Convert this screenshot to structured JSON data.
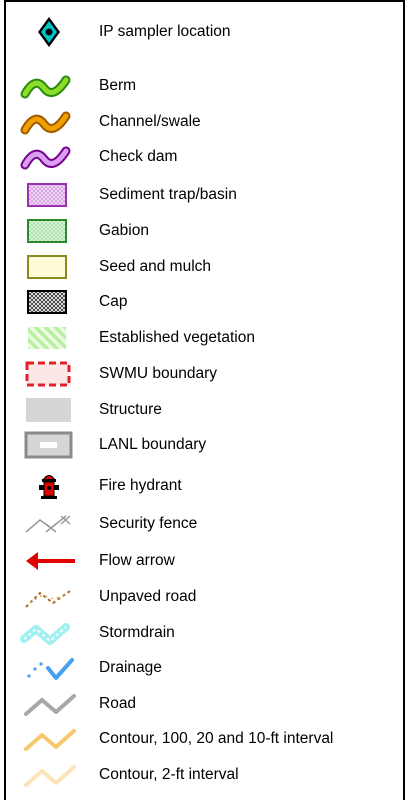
{
  "legend": {
    "items": [
      {
        "id": "ip-sampler",
        "label": "IP sampler location",
        "icon": "diamond-icon",
        "color": "#00c8c8"
      },
      {
        "id": "berm",
        "label": "Berm",
        "icon": "berm-icon",
        "color": "#8cdc28"
      },
      {
        "id": "channel",
        "label": "Channel/swale",
        "icon": "channel-swale-icon",
        "color": "#f0a000"
      },
      {
        "id": "check-dam",
        "label": "Check dam",
        "icon": "check-dam-icon",
        "color": "#b400c8"
      },
      {
        "id": "sediment",
        "label": "Sediment trap/basin",
        "icon": "sediment-trap-icon",
        "color": "#9b30b0"
      },
      {
        "id": "gabion",
        "label": "Gabion",
        "icon": "gabion-icon",
        "color": "#3c9a3c"
      },
      {
        "id": "seed",
        "label": "Seed and mulch",
        "icon": "seed-mulch-icon",
        "color": "#a09a2a"
      },
      {
        "id": "cap",
        "label": "Cap",
        "icon": "cap-icon",
        "color": "#000000"
      },
      {
        "id": "vegetation",
        "label": "Established vegetation",
        "icon": "vegetation-icon",
        "color": "#b8f0a0"
      },
      {
        "id": "swmu",
        "label": "SWMU boundary",
        "icon": "swmu-boundary-icon",
        "color": "#e0202a"
      },
      {
        "id": "structure",
        "label": "Structure",
        "icon": "structure-icon",
        "color": "#d6d6d6"
      },
      {
        "id": "lanl",
        "label": "LANL boundary",
        "icon": "lanl-boundary-icon",
        "color": "#8a8a8a"
      },
      {
        "id": "hydrant",
        "label": "Fire hydrant",
        "icon": "fire-hydrant-icon",
        "color": "#e00000"
      },
      {
        "id": "fence",
        "label": "Security fence",
        "icon": "security-fence-icon",
        "color": "#9a9a9a"
      },
      {
        "id": "flow",
        "label": "Flow arrow",
        "icon": "flow-arrow-icon",
        "color": "#e00000"
      },
      {
        "id": "unpaved",
        "label": "Unpaved road",
        "icon": "unpaved-road-icon",
        "color": "#b06a2a"
      },
      {
        "id": "stormdrain",
        "label": "Stormdrain",
        "icon": "stormdrain-icon",
        "color": "#a0f0f0"
      },
      {
        "id": "drainage",
        "label": "Drainage",
        "icon": "drainage-icon",
        "color": "#4aa0f0"
      },
      {
        "id": "road",
        "label": "Road",
        "icon": "road-icon",
        "color": "#a8a8a8"
      },
      {
        "id": "contour-100",
        "label": "Contour, 100, 20 and 10-ft interval",
        "icon": "contour-major-icon",
        "color": "#f8c870"
      },
      {
        "id": "contour-2",
        "label": "Contour, 2-ft interval",
        "icon": "contour-minor-icon",
        "color": "#fce4b8"
      }
    ]
  }
}
